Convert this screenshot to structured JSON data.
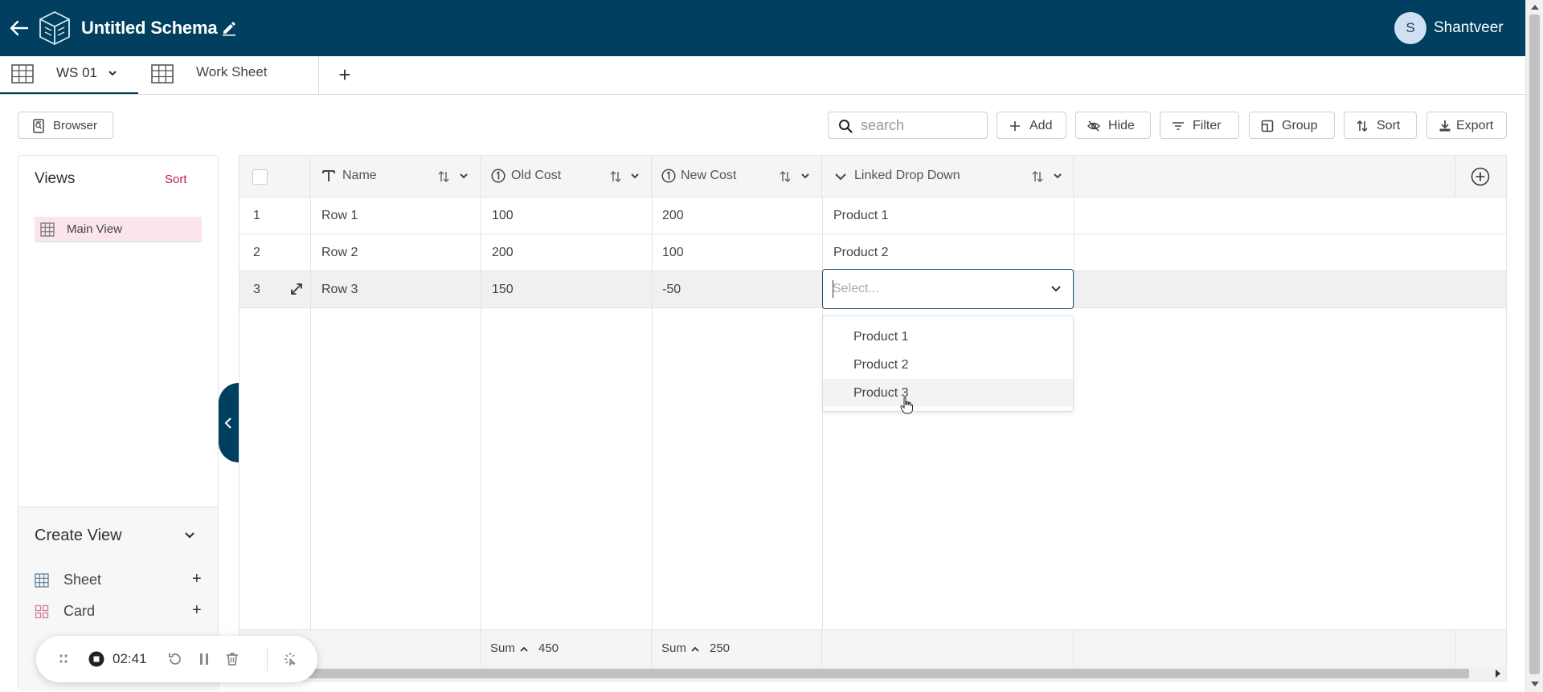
{
  "header": {
    "title": "Untitled Schema",
    "avatar_initial": "S",
    "username": "Shantveer"
  },
  "tabs": [
    {
      "label": "WS 01"
    },
    {
      "label": "Work Sheet"
    }
  ],
  "toolbar": {
    "browser_label": "Browser",
    "search_placeholder": "search",
    "add_label": "Add",
    "hide_label": "Hide",
    "filter_label": "Filter",
    "group_label": "Group",
    "sort_label": "Sort",
    "export_label": "Export"
  },
  "views": {
    "title": "Views",
    "sort_label": "Sort",
    "items": [
      {
        "label": "Main View"
      }
    ],
    "create": {
      "title": "Create View",
      "items": [
        {
          "label": "Sheet"
        },
        {
          "label": "Card"
        }
      ]
    }
  },
  "grid": {
    "columns": [
      "Name",
      "Old Cost",
      "New Cost",
      "Linked Drop Down"
    ],
    "rows": [
      {
        "num": "1",
        "name": "Row 1",
        "old_cost": "100",
        "new_cost": "200",
        "linked": "Product 1"
      },
      {
        "num": "2",
        "name": "Row 2",
        "old_cost": "200",
        "new_cost": "100",
        "linked": "Product 2"
      },
      {
        "num": "3",
        "name": "Row 3",
        "old_cost": "150",
        "new_cost": "-50",
        "linked": ""
      }
    ],
    "footer": {
      "old_cost": {
        "label": "Sum",
        "value": "450"
      },
      "new_cost": {
        "label": "Sum",
        "value": "250"
      }
    }
  },
  "dropdown": {
    "placeholder": "Select...",
    "options": [
      "Product 1",
      "Product 2",
      "Product 3"
    ],
    "hovered": "Product 3"
  },
  "recorder": {
    "time": "02:41"
  },
  "colors": {
    "header_bg": "#003f5f",
    "accent_pink": "#c2185b",
    "selected_view_bg": "#fbe4ec"
  }
}
